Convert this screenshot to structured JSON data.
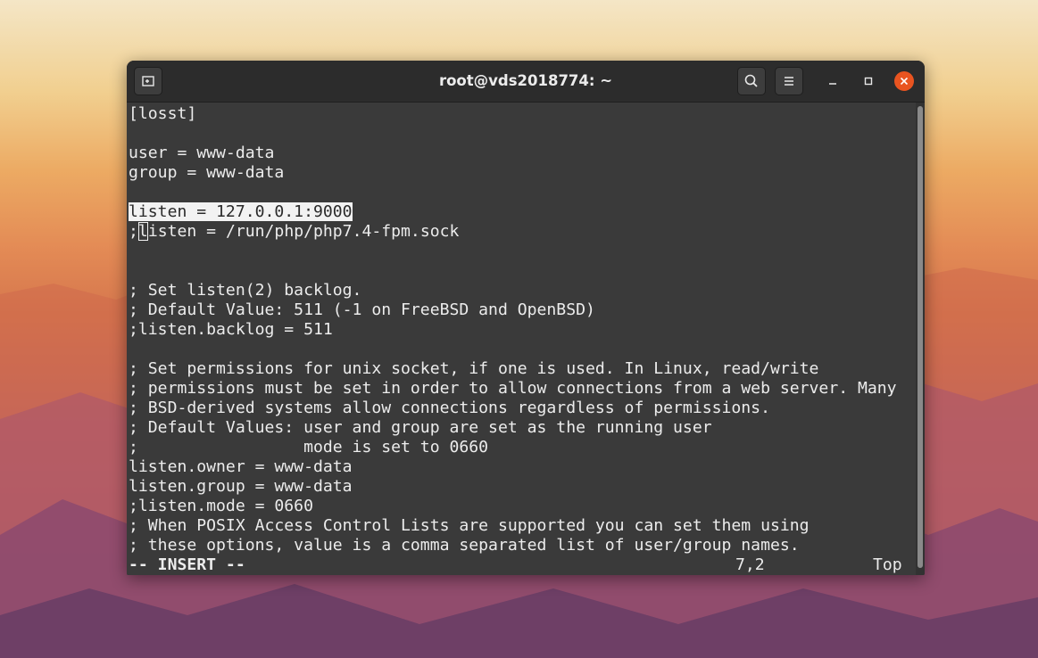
{
  "window": {
    "title": "root@vds2018774: ~"
  },
  "icons": {
    "new_tab": "new-tab-icon",
    "search": "search-icon",
    "menu": "hamburger-menu-icon",
    "minimize": "minimize-icon",
    "maximize": "maximize-icon",
    "close": "close-icon"
  },
  "colors": {
    "close_button": "#e95420",
    "terminal_background": "#3a3a3a",
    "text": "#ececec"
  },
  "editor": {
    "lines": [
      "[losst]",
      "",
      "user = www-data",
      "group = www-data",
      "",
      "listen = 127.0.0.1:9000",
      ";listen = /run/php/php7.4-fpm.sock",
      "",
      "",
      "; Set listen(2) backlog.",
      "; Default Value: 511 (-1 on FreeBSD and OpenBSD)",
      ";listen.backlog = 511",
      "",
      "; Set permissions for unix socket, if one is used. In Linux, read/write",
      "; permissions must be set in order to allow connections from a web server. Many",
      "; BSD-derived systems allow connections regardless of permissions.",
      "; Default Values: user and group are set as the running user",
      ";                 mode is set to 0660",
      "listen.owner = www-data",
      "listen.group = www-data",
      ";listen.mode = 0660",
      "; When POSIX Access Control Lists are supported you can set them using",
      "; these options, value is a comma separated list of user/group names."
    ],
    "line7_prefix": ";",
    "line7_cursor_char": "l",
    "line7_rest": "isten = /run/php/php7.4-fpm.sock",
    "status": {
      "mode": "-- INSERT --",
      "position": "7,2",
      "scroll": "Top"
    }
  }
}
